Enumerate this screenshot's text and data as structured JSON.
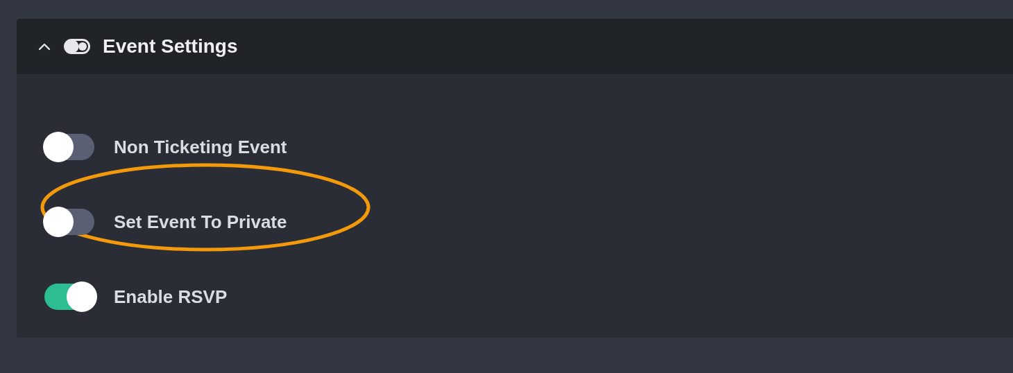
{
  "section": {
    "title": "Event Settings",
    "expanded": true
  },
  "settings": [
    {
      "label": "Non Ticketing Event",
      "on": false,
      "highlighted": false
    },
    {
      "label": "Set Event To Private",
      "on": false,
      "highlighted": true
    },
    {
      "label": "Enable RSVP",
      "on": true,
      "highlighted": false
    }
  ]
}
